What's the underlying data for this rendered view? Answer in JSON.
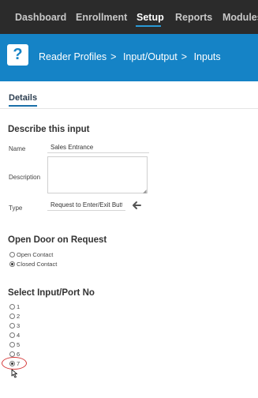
{
  "nav": {
    "items": [
      "Dashboard",
      "Enrollment",
      "Setup",
      "Reports",
      "Modules"
    ],
    "active": "Setup"
  },
  "header": {
    "icon": "question-icon",
    "icon_glyph": "?",
    "breadcrumb": [
      "Reader Profiles",
      "Input/Output",
      "Inputs"
    ],
    "separator": ">"
  },
  "tabs": {
    "details": "Details"
  },
  "describe": {
    "title": "Describe this input",
    "name_label": "Name",
    "name_value": "Sales Entrance",
    "description_label": "Description",
    "description_value": "",
    "type_label": "Type",
    "type_value": "Request to Enter/Exit Butto",
    "type_icon": "arrow-left-icon"
  },
  "open_door": {
    "title": "Open Door on Request",
    "options": [
      "Open Contact",
      "Closed Contact"
    ],
    "selected": "Closed Contact"
  },
  "port": {
    "title": "Select Input/Port No",
    "options": [
      "1",
      "2",
      "3",
      "4",
      "5",
      "6",
      "7"
    ],
    "selected": "7"
  },
  "colors": {
    "nav_bg": "#2b2b2b",
    "header_bg": "#1583c6",
    "accent": "#2a9ad6",
    "highlight": "#d63b3b"
  }
}
